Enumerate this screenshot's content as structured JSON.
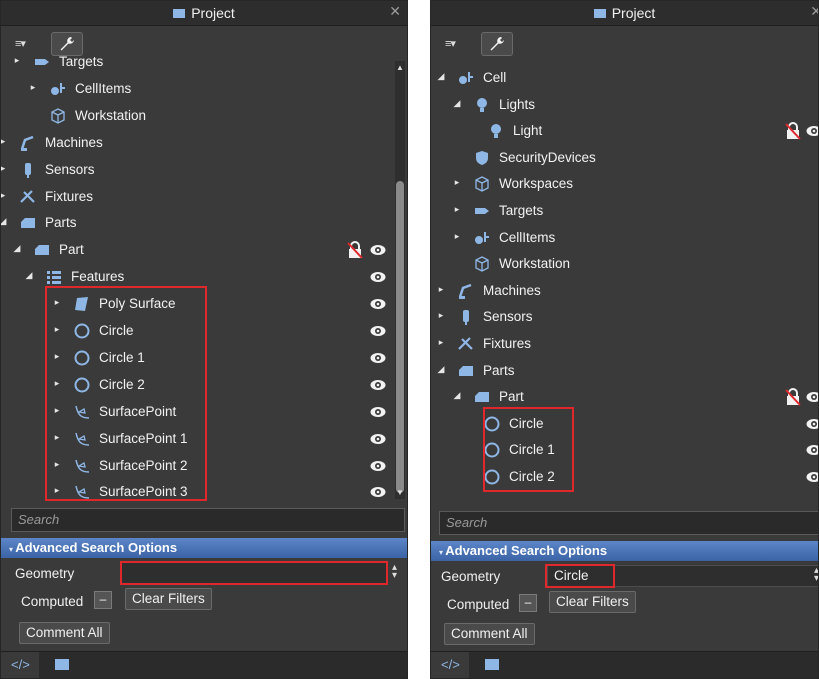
{
  "left": {
    "title": "Project",
    "close": "✕",
    "rows": [
      {
        "label": "Targets",
        "arrow": "▸",
        "icon": "target-icon"
      },
      {
        "label": "CellItems",
        "arrow": "▸",
        "icon": "cellitems-icon"
      },
      {
        "label": "Workstation",
        "arrow": "",
        "icon": "workstation-icon"
      },
      {
        "label": "Machines",
        "arrow": "▸",
        "icon": "machine-icon"
      },
      {
        "label": "Sensors",
        "arrow": "▸",
        "icon": "sensor-icon"
      },
      {
        "label": "Fixtures",
        "arrow": "▸",
        "icon": "fixture-icon"
      },
      {
        "label": "Parts",
        "arrow": "◢",
        "icon": "part-icon"
      },
      {
        "label": "Part",
        "arrow": "◢",
        "icon": "part-icon"
      },
      {
        "label": "Features",
        "arrow": "◢",
        "icon": "features-icon"
      },
      {
        "label": "Poly Surface",
        "arrow": "▸",
        "icon": "polysurface-icon"
      },
      {
        "label": "Circle",
        "arrow": "▸",
        "icon": "circle-icon"
      },
      {
        "label": "Circle 1",
        "arrow": "▸",
        "icon": "circle-icon"
      },
      {
        "label": "Circle 2",
        "arrow": "▸",
        "icon": "circle-icon"
      },
      {
        "label": "SurfacePoint",
        "arrow": "▸",
        "icon": "surfacepoint-icon"
      },
      {
        "label": "SurfacePoint 1",
        "arrow": "▸",
        "icon": "surfacepoint-icon"
      },
      {
        "label": "SurfacePoint 2",
        "arrow": "▸",
        "icon": "surfacepoint-icon"
      },
      {
        "label": "SurfacePoint 3",
        "arrow": "▸",
        "icon": "surfacepoint-icon"
      }
    ],
    "search_placeholder": "Search",
    "advanced_label": "Advanced Search Options",
    "geometry_label": "Geometry",
    "geometry_value": "",
    "computed_label": "Computed",
    "clear_filters": "Clear Filters",
    "comment_all": "Comment All"
  },
  "right": {
    "title": "Project",
    "close": "✕",
    "rows": [
      {
        "label": "Cell",
        "arrow": "◢",
        "icon": "cellitems-icon"
      },
      {
        "label": "Lights",
        "arrow": "◢",
        "icon": "light-icon"
      },
      {
        "label": "Light",
        "arrow": "",
        "icon": "light-icon"
      },
      {
        "label": "SecurityDevices",
        "arrow": "",
        "icon": "shield-icon"
      },
      {
        "label": "Workspaces",
        "arrow": "▸",
        "icon": "workstation-icon"
      },
      {
        "label": "Targets",
        "arrow": "▸",
        "icon": "target-icon"
      },
      {
        "label": "CellItems",
        "arrow": "▸",
        "icon": "cellitems-icon"
      },
      {
        "label": "Workstation",
        "arrow": "",
        "icon": "workstation-icon"
      },
      {
        "label": "Machines",
        "arrow": "▸",
        "icon": "machine-icon"
      },
      {
        "label": "Sensors",
        "arrow": "▸",
        "icon": "sensor-icon"
      },
      {
        "label": "Fixtures",
        "arrow": "▸",
        "icon": "fixture-icon"
      },
      {
        "label": "Parts",
        "arrow": "◢",
        "icon": "part-icon"
      },
      {
        "label": "Part",
        "arrow": "◢",
        "icon": "part-icon"
      },
      {
        "label": "Circle",
        "arrow": "",
        "icon": "circle-icon"
      },
      {
        "label": "Circle 1",
        "arrow": "",
        "icon": "circle-icon"
      },
      {
        "label": "Circle 2",
        "arrow": "",
        "icon": "circle-icon"
      }
    ],
    "search_placeholder": "Search",
    "advanced_label": "Advanced Search Options",
    "geometry_label": "Geometry",
    "geometry_value": "Circle",
    "computed_label": "Computed",
    "clear_filters": "Clear Filters",
    "comment_all": "Comment All"
  },
  "colors": {
    "panel": "#3a3a3a",
    "accent": "#8fb7e6",
    "highlight": "#e0282c",
    "advanced_bar": "#4a74b8"
  }
}
